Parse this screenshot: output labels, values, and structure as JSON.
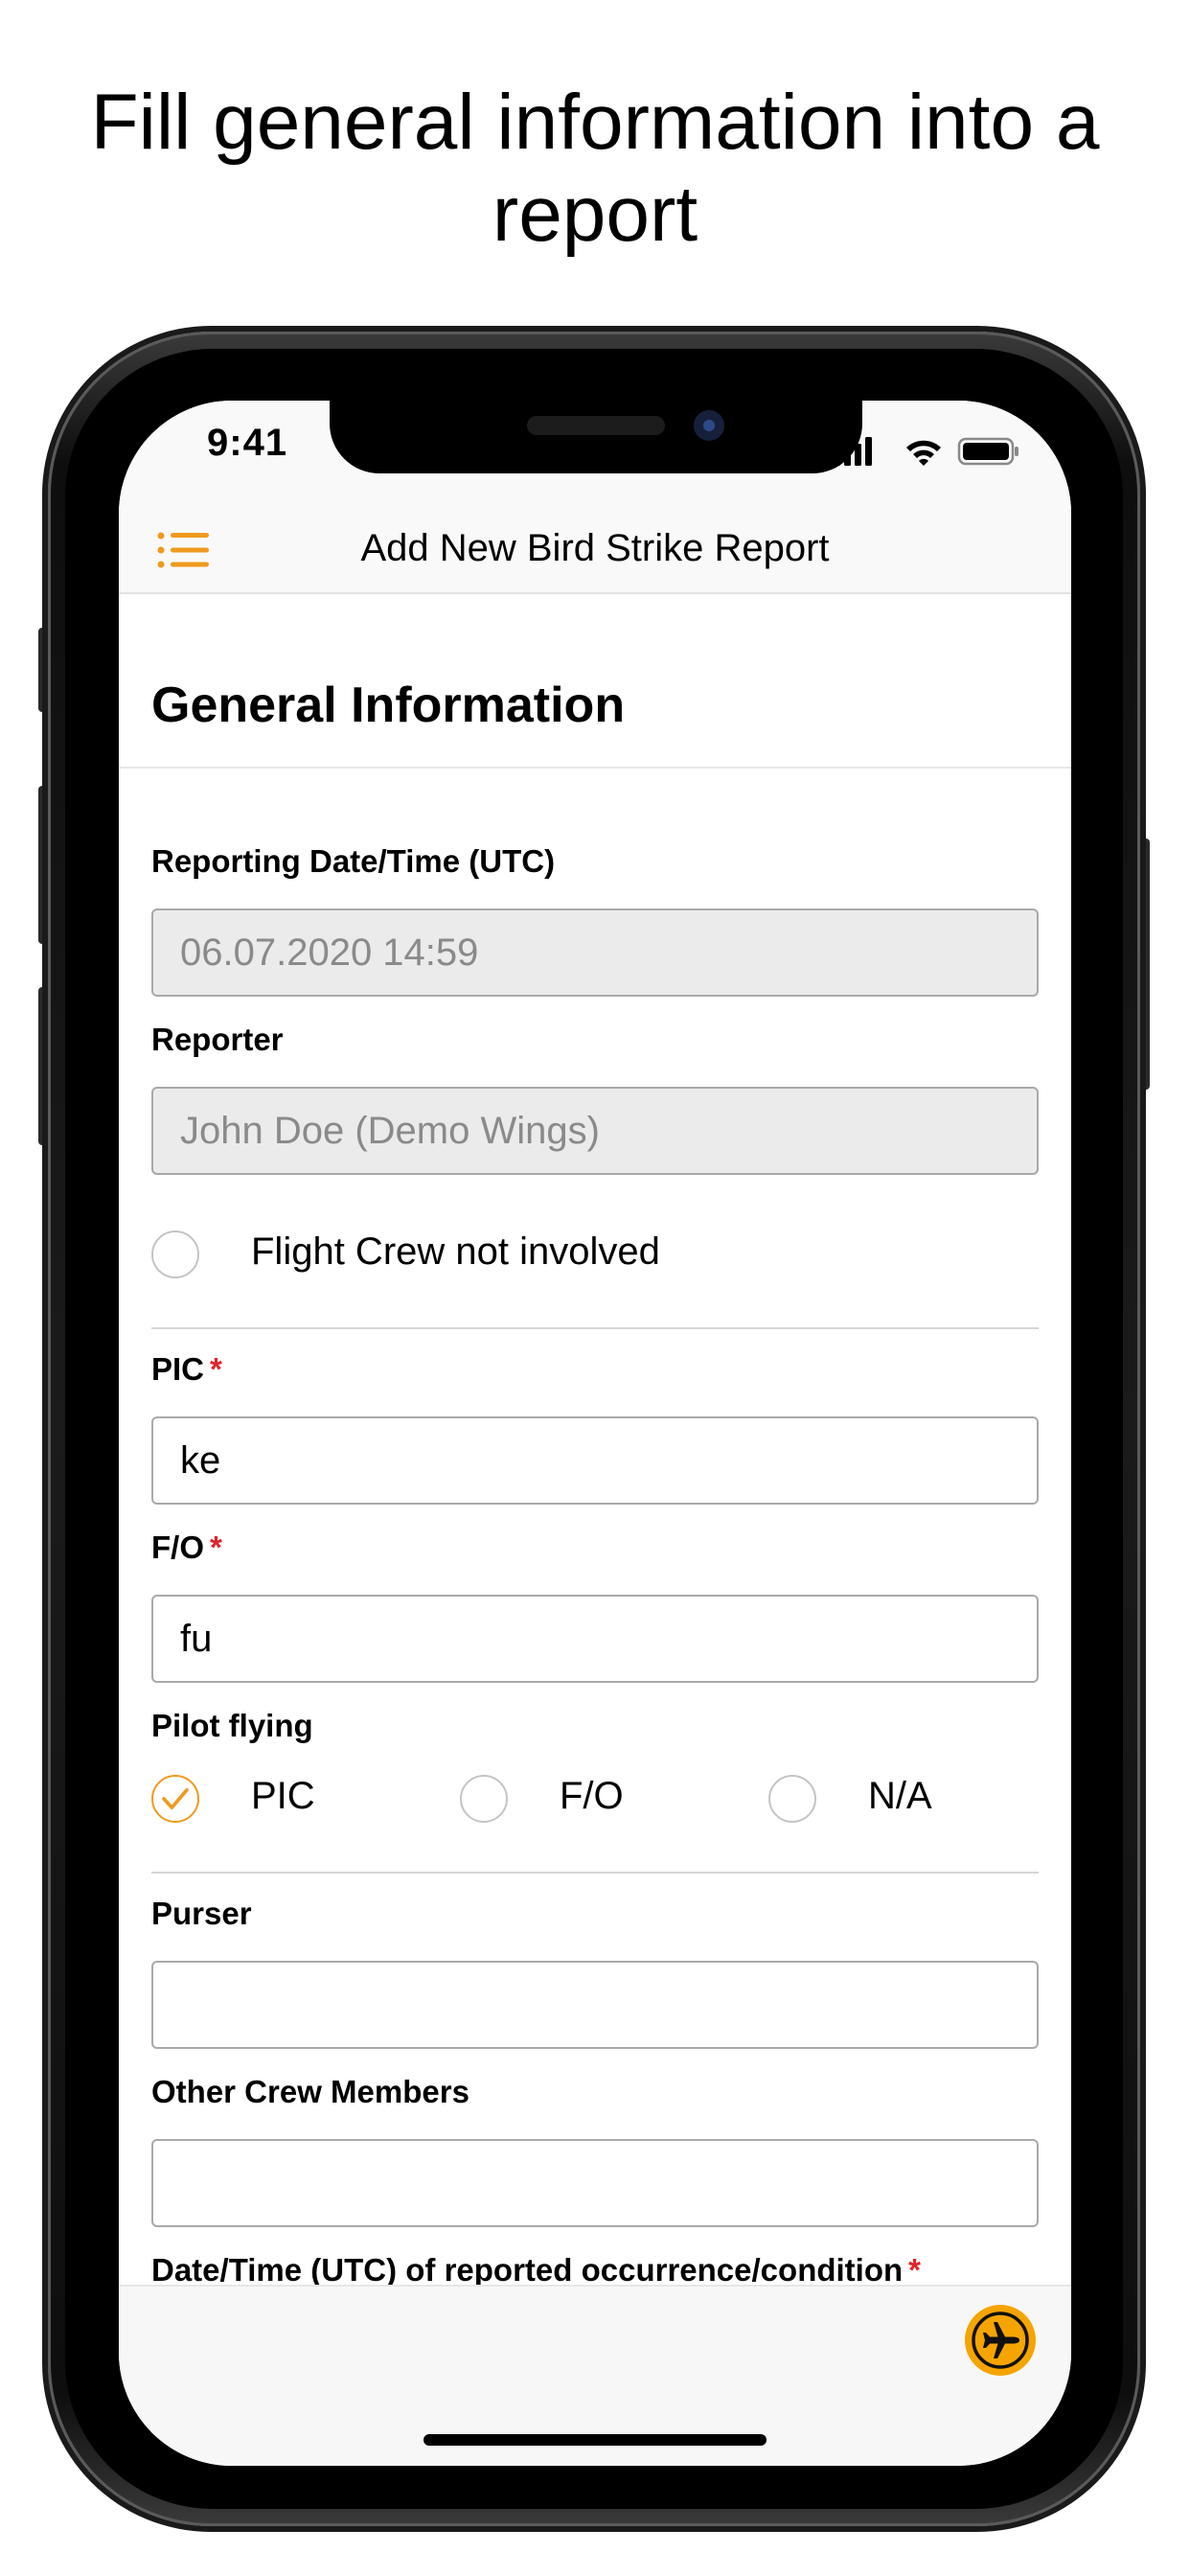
{
  "headline": "Fill general information into a report",
  "status_bar": {
    "time": "9:41",
    "icons": [
      "signal-icon",
      "wifi-icon",
      "battery-icon"
    ]
  },
  "nav": {
    "title": "Add New Bird Strike Report",
    "menu_icon": "list-menu-icon"
  },
  "form": {
    "section_title": "General Information",
    "reporting_datetime": {
      "label": "Reporting Date/Time (UTC)",
      "value": "06.07.2020 14:59"
    },
    "reporter": {
      "label": "Reporter",
      "value": "John Doe (Demo Wings)"
    },
    "flight_crew_not_involved": {
      "label": "Flight Crew not involved",
      "checked": false
    },
    "pic": {
      "label": "PIC",
      "required_mark": "*",
      "value": "ke"
    },
    "fo": {
      "label": "F/O",
      "required_mark": "*",
      "value": "fu"
    },
    "pilot_flying": {
      "label": "Pilot flying",
      "options": [
        {
          "label": "PIC",
          "selected": true
        },
        {
          "label": "F/O",
          "selected": false
        },
        {
          "label": "N/A",
          "selected": false
        }
      ]
    },
    "purser": {
      "label": "Purser",
      "value": ""
    },
    "other_crew": {
      "label": "Other Crew Members",
      "value": ""
    },
    "occurrence_datetime": {
      "label": "Date/Time (UTC) of reported occurrence/condition",
      "required_mark": "*",
      "value": ""
    }
  },
  "bottom_bar": {
    "fab_icon": "airplane-icon"
  },
  "colors": {
    "accent": "#f09a1e",
    "required": "#e0242c",
    "fab": "#f5a400"
  }
}
